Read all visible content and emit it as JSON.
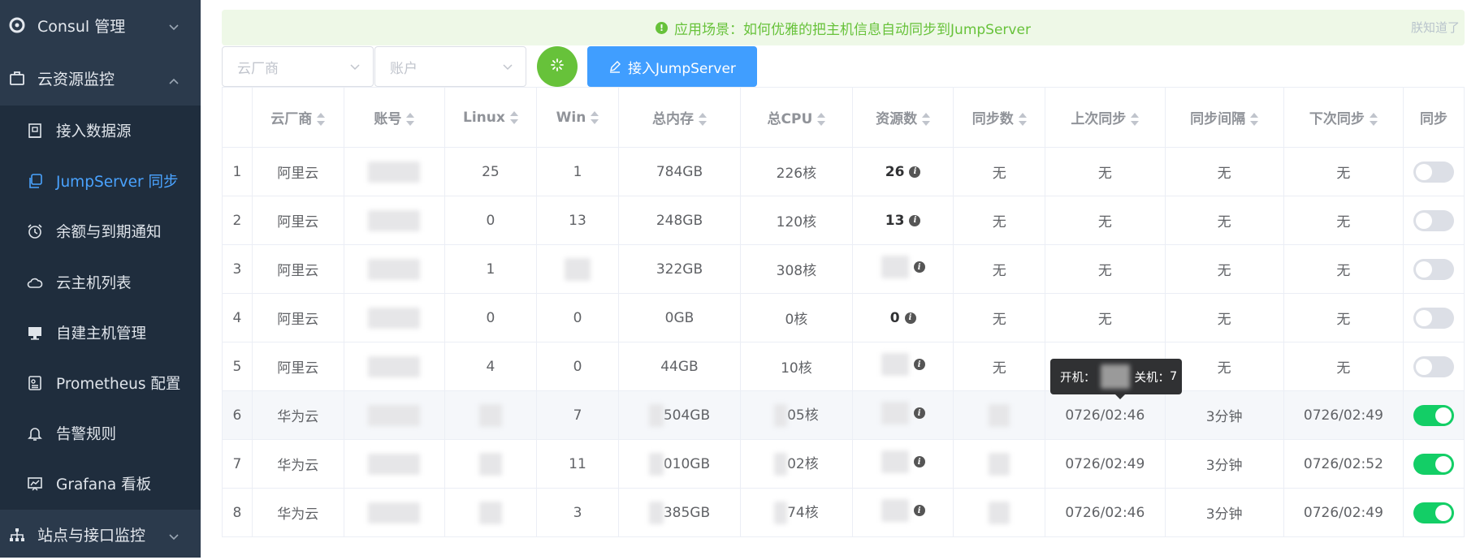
{
  "sidebar": {
    "group_consul": "Consul 管理",
    "group_cloud": "云资源监控",
    "items": [
      {
        "label": "接入数据源"
      },
      {
        "label": "JumpServer 同步"
      },
      {
        "label": "余额与到期通知"
      },
      {
        "label": "云主机列表"
      },
      {
        "label": "自建主机管理"
      },
      {
        "label": "Prometheus 配置"
      },
      {
        "label": "告警规则"
      },
      {
        "label": "Grafana 看板"
      }
    ],
    "group_site": "站点与接口监控"
  },
  "alert": {
    "text": "应用场景：如何优雅的把主机信息自动同步到JumpServer",
    "dismiss": "朕知道了"
  },
  "filters": {
    "vendor_placeholder": "云厂商",
    "account_placeholder": "账户",
    "jump_button": "接入JumpServer"
  },
  "table": {
    "headers": [
      "",
      "云厂商",
      "账号",
      "Linux",
      "Win",
      "总内存",
      "总CPU",
      "资源数",
      "同步数",
      "上次同步",
      "同步间隔",
      "下次同步",
      "同步"
    ],
    "rows": [
      {
        "idx": "1",
        "vendor": "阿里云",
        "linux": "25",
        "win": "1",
        "mem": "784GB",
        "cpu": "226核",
        "res": "26",
        "sync": "无",
        "last": "无",
        "interval": "无",
        "next": "无",
        "enabled": false
      },
      {
        "idx": "2",
        "vendor": "阿里云",
        "linux": "0",
        "win": "13",
        "mem": "248GB",
        "cpu": "120核",
        "res": "13",
        "sync": "无",
        "last": "无",
        "interval": "无",
        "next": "无",
        "enabled": false
      },
      {
        "idx": "3",
        "vendor": "阿里云",
        "linux": "1",
        "win": "",
        "mem": "322GB",
        "cpu": "308核",
        "res": "",
        "sync": "无",
        "last": "无",
        "interval": "无",
        "next": "无",
        "enabled": false
      },
      {
        "idx": "4",
        "vendor": "阿里云",
        "linux": "0",
        "win": "0",
        "mem": "0GB",
        "cpu": "0核",
        "res": "0",
        "sync": "无",
        "last": "无",
        "interval": "无",
        "next": "无",
        "enabled": false
      },
      {
        "idx": "5",
        "vendor": "阿里云",
        "linux": "4",
        "win": "0",
        "mem": "44GB",
        "cpu": "10核",
        "res": "",
        "sync": "无",
        "last": "无",
        "interval": "无",
        "next": "无",
        "enabled": false
      },
      {
        "idx": "6",
        "vendor": "华为云",
        "linux": "",
        "win": "7",
        "mem": "504GB",
        "cpu": "05核",
        "res": "",
        "sync": "",
        "last": "0726/02:46",
        "interval": "3分钟",
        "next": "0726/02:49",
        "enabled": true
      },
      {
        "idx": "7",
        "vendor": "华为云",
        "linux": "",
        "win": "11",
        "mem": "010GB",
        "cpu": "02核",
        "res": "",
        "sync": "",
        "last": "0726/02:49",
        "interval": "3分钟",
        "next": "0726/02:52",
        "enabled": true
      },
      {
        "idx": "8",
        "vendor": "华为云",
        "linux": "",
        "win": "3",
        "mem": "385GB",
        "cpu": "74核",
        "res": "",
        "sync": "",
        "last": "0726/02:46",
        "interval": "3分钟",
        "next": "0726/02:49",
        "enabled": true
      }
    ]
  },
  "tooltip": {
    "on_label": "开机：",
    "off_label": "关机：",
    "off_value": "7"
  },
  "colors": {
    "sidebar_bg": "#2b3a4c",
    "submenu_bg": "#1f2d3d",
    "active": "#4aa3ff",
    "alert_green": "#67c23a",
    "primary": "#409eff",
    "switch_on": "#13ce66"
  }
}
